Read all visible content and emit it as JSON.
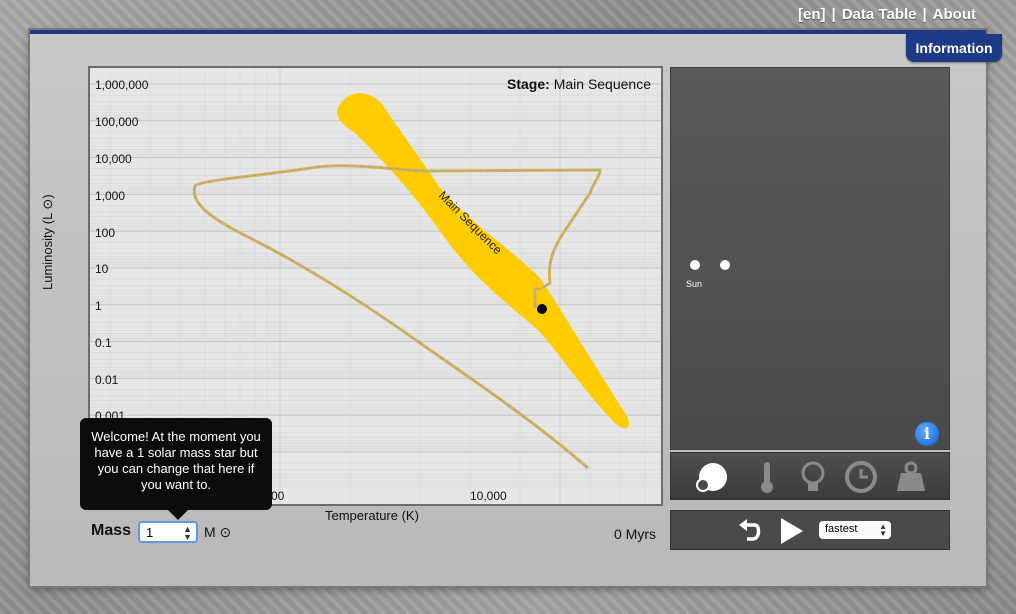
{
  "topbar": {
    "links": [
      "[en]",
      "Data Table",
      "About"
    ]
  },
  "info_tab": "Information",
  "chart": {
    "stage_label": "Stage:",
    "stage_value": "Main Sequence",
    "band_label": "Main Sequence",
    "ylabel": "Luminosity (L ⊙)",
    "xlabel": "Temperature (K)",
    "yticks": [
      "1,000,000",
      "100,000",
      "10,000",
      "1,000",
      "100",
      "10",
      "1",
      "0.1",
      "0.01",
      "0.001"
    ],
    "xticks": [
      "00",
      "10,000"
    ],
    "colors": {
      "band": "#ffcc00",
      "track": "#d9b24a",
      "track_dash": "#9da9b8",
      "star": "#000000"
    }
  },
  "chart_data": {
    "type": "scatter",
    "title": "",
    "xlabel": "Temperature (K)",
    "ylabel": "Luminosity (L ⊙)",
    "yscale": "log",
    "xscale": "log-reversed",
    "ylim": [
      0.0001,
      3000000
    ],
    "yticks": [
      1000000,
      100000,
      10000,
      1000,
      100,
      10,
      1,
      0.1,
      0.01,
      0.001
    ],
    "current_star": {
      "temperature": 5800,
      "luminosity": 1
    },
    "grid": true
  },
  "controls": {
    "mass_label": "Mass",
    "mass_value": "1",
    "mass_unit": "M ⊙",
    "age": "0 Myrs",
    "speed": "fastest"
  },
  "tooltip": "Welcome! At the moment you have a 1 solar mass star but you can change that here if you want to.",
  "viewer": {
    "sun_label": "Sun"
  }
}
